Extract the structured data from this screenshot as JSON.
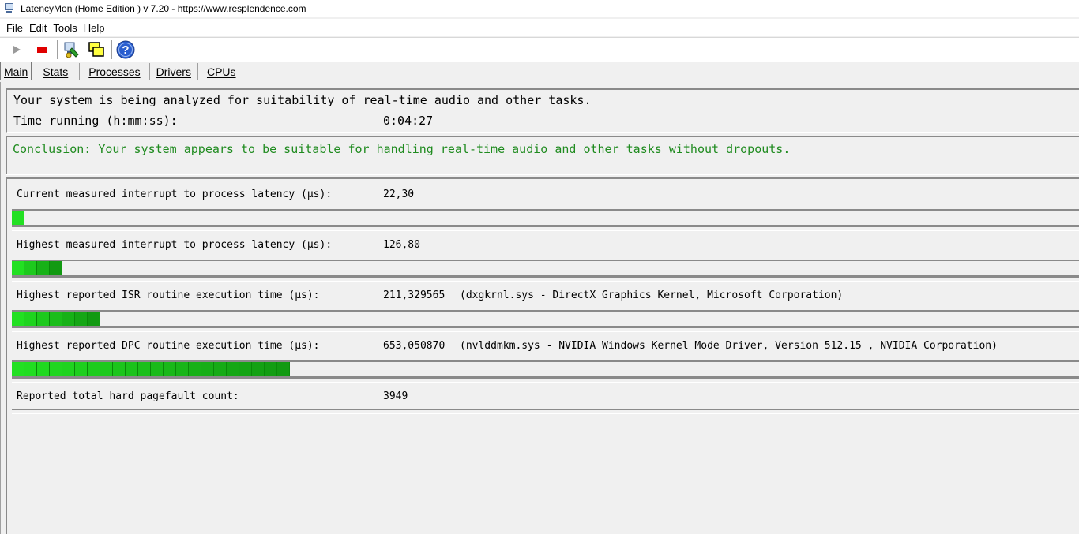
{
  "window": {
    "title": "LatencyMon  (Home Edition )  v 7.20 - https://www.resplendence.com"
  },
  "menu": [
    "File",
    "Edit",
    "Tools",
    "Help"
  ],
  "toolbar": {
    "buttons": [
      "play-icon",
      "stop-icon",
      "drivers-icon",
      "windows-icon",
      "help-icon"
    ]
  },
  "tabs": [
    "Main",
    "Stats",
    "Processes",
    "Drivers",
    "CPUs"
  ],
  "status": {
    "analyzing": "Your system is being analyzed for suitability of real-time audio and other tasks.",
    "time_label": "Time running (h:mm:ss):",
    "time_value": "0:04:27"
  },
  "conclusion": "Conclusion: Your system appears to be suitable for handling real-time audio and other tasks without dropouts.",
  "metrics": [
    {
      "label": "Current measured interrupt to process latency (µs):",
      "value": "22,30",
      "detail": "",
      "bar_segments": 1
    },
    {
      "label": "Highest measured interrupt to process latency (µs):",
      "value": "126,80",
      "detail": "",
      "bar_segments": 4
    },
    {
      "label": "Highest reported ISR routine execution time (µs):",
      "value": "211,329565",
      "detail": "(dxgkrnl.sys - DirectX Graphics Kernel, Microsoft Corporation)",
      "bar_segments": 7
    },
    {
      "label": "Highest reported DPC routine execution time (µs):",
      "value": "653,050870",
      "detail": "(nvlddmkm.sys - NVIDIA Windows Kernel Mode Driver, Version 512.15 , NVIDIA Corporation)",
      "bar_segments": 22
    },
    {
      "label": "Reported total hard pagefault count:",
      "value": "3949",
      "detail": ""
    }
  ],
  "colors": {
    "conclusion": "#1f8b1f",
    "bar_light": "#22e022",
    "bar_dark": "#129a12"
  }
}
